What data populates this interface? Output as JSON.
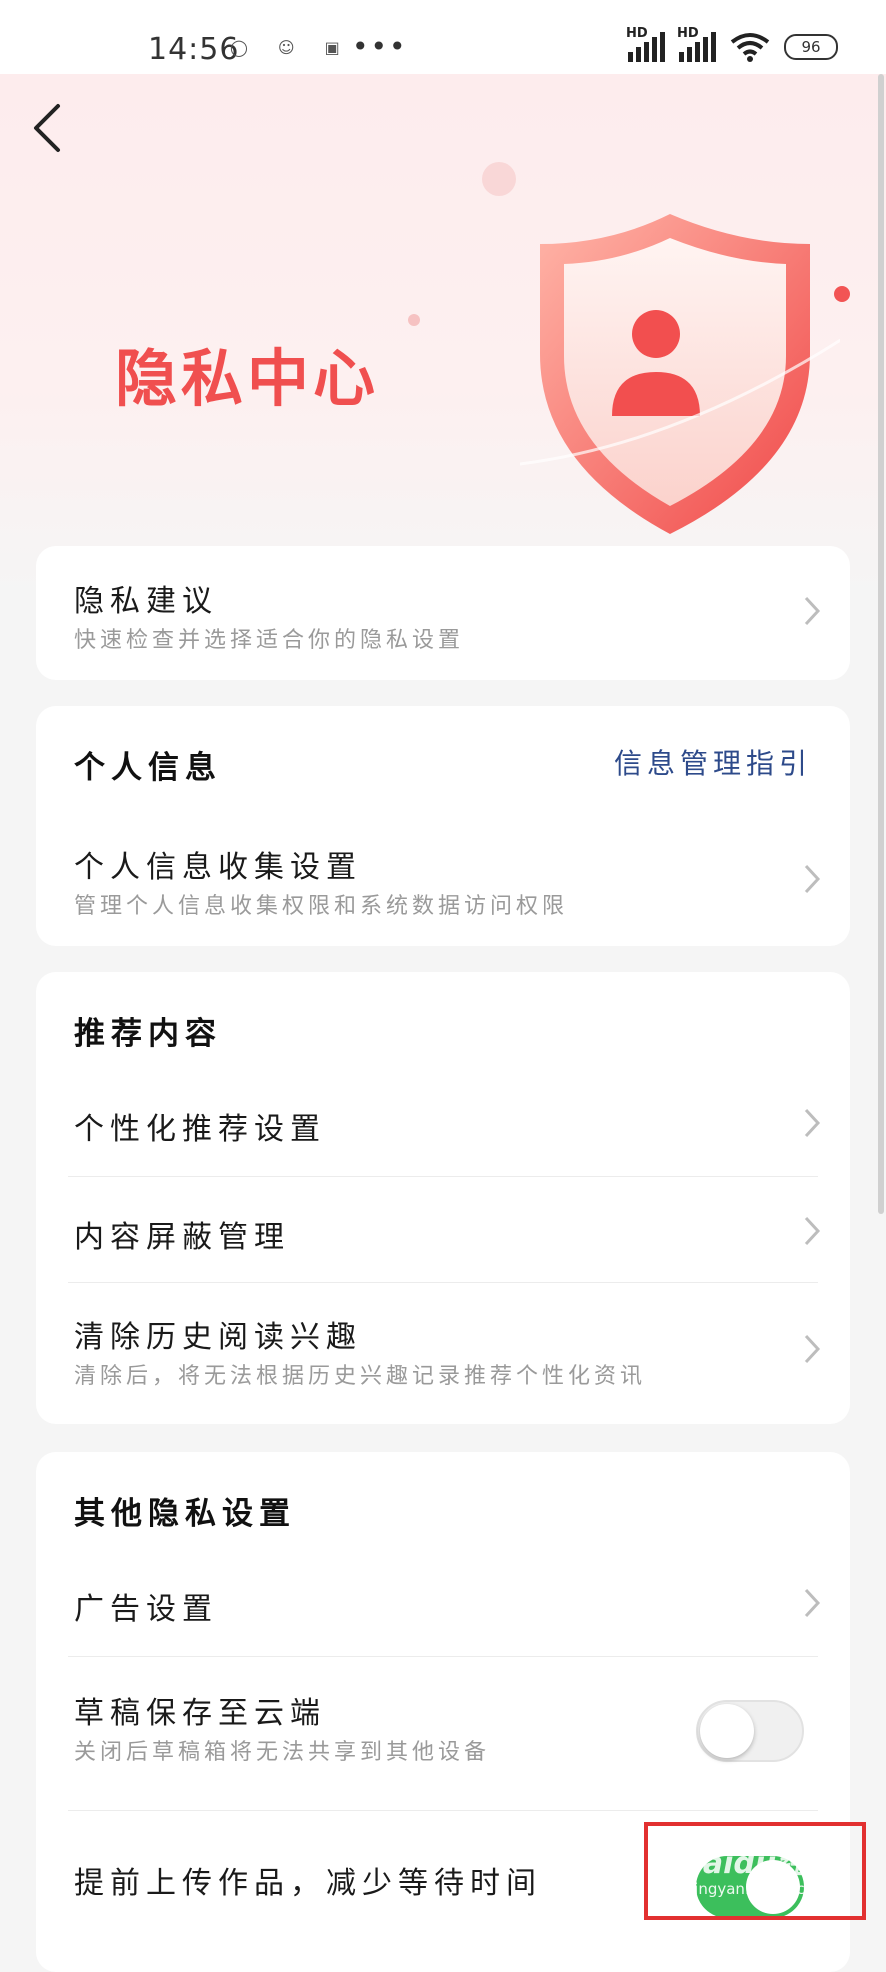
{
  "status_bar": {
    "time": "14:56",
    "network_label": "HD",
    "battery": "96"
  },
  "header": {
    "title": "隐私中心"
  },
  "privacy_suggest": {
    "title": "隐私建议",
    "subtitle": "快速检查并选择适合你的隐私设置"
  },
  "personal_info": {
    "section_title": "个人信息",
    "guide_link": "信息管理指引",
    "collect_title": "个人信息收集设置",
    "collect_subtitle": "管理个人信息收集权限和系统数据访问权限"
  },
  "recommend": {
    "section_title": "推荐内容",
    "items": [
      {
        "title": "个性化推荐设置"
      },
      {
        "title": "内容屏蔽管理"
      },
      {
        "title": "清除历史阅读兴趣",
        "subtitle": "清除后，将无法根据历史兴趣记录推荐个性化资讯"
      }
    ]
  },
  "other": {
    "section_title": "其他隐私设置",
    "ad_title": "广告设置",
    "draft_title": "草稿保存至云端",
    "draft_subtitle": "关闭后草稿箱将无法共享到其他设备",
    "draft_toggle": "off",
    "upload_title": "提前上传作品，减少等待时间",
    "upload_toggle": "on"
  },
  "watermark": {
    "text": "Baidu经验",
    "sub": "jingyan.baidu.com"
  },
  "colors": {
    "accent_red": "#f04f4f",
    "link_blue": "#2d4a8a",
    "toggle_on": "#3cbf5c"
  }
}
